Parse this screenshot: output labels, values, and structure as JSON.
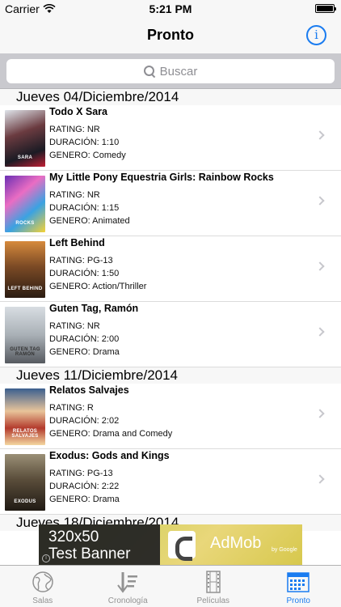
{
  "status_bar": {
    "carrier": "Carrier",
    "time": "5:21 PM"
  },
  "nav": {
    "title": "Pronto"
  },
  "search": {
    "placeholder": "Buscar"
  },
  "sections": [
    {
      "header": "Jueves 04/Diciembre/2014",
      "movies": [
        {
          "title": "Todo X Sara",
          "rating": "RATING: NR",
          "duration": "DURACIÓN: 1:10",
          "genre": "GENERO: Comedy",
          "poster_text": "SARA"
        },
        {
          "title": "My Little Pony Equestria Girls: Rainbow Rocks",
          "rating": "RATING: NR",
          "duration": "DURACIÓN: 1:15",
          "genre": "GENERO: Animated",
          "poster_text": "ROCKS"
        },
        {
          "title": "Left Behind",
          "rating": "RATING: PG-13",
          "duration": "DURACIÓN: 1:50",
          "genre": "GENERO: Action/Thriller",
          "poster_text": "LEFT BEHIND"
        },
        {
          "title": "Guten Tag, Ramón",
          "rating": "RATING: NR",
          "duration": "DURACIÓN: 2:00",
          "genre": "GENERO: Drama",
          "poster_text": "GUTEN TAG RAMÓN"
        }
      ]
    },
    {
      "header": "Jueves 11/Diciembre/2014",
      "movies": [
        {
          "title": "Relatos Salvajes",
          "rating": "RATING: R",
          "duration": "DURACIÓN: 2:02",
          "genre": "GENERO: Drama and Comedy",
          "poster_text": "RELATOS SALVAJES"
        },
        {
          "title": "Exodus: Gods and Kings",
          "rating": "RATING: PG-13",
          "duration": "DURACIÓN: 2:22",
          "genre": "GENERO: Drama",
          "poster_text": "EXODUS"
        }
      ]
    },
    {
      "header": "Jueves 18/Diciembre/2014",
      "movies": []
    }
  ],
  "ad": {
    "line1": "320x50",
    "line2": "Test Banner",
    "brand": "AdMob",
    "brand_sub": "by Google"
  },
  "tabs": [
    {
      "label": "Salas",
      "icon": "globe-icon"
    },
    {
      "label": "Cronología",
      "icon": "sort-down-icon"
    },
    {
      "label": "Películas",
      "icon": "film-icon"
    },
    {
      "label": "Pronto",
      "icon": "calendar-icon",
      "active": true
    }
  ],
  "colors": {
    "accent": "#1a7cf0",
    "inactive_tab": "#929292",
    "search_bg": "#c9c9ce"
  }
}
